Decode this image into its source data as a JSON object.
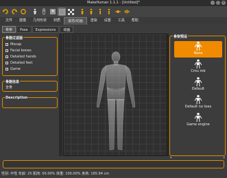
{
  "window": {
    "title": "MakeHuman 1.1.1 - [Untitled]*"
  },
  "toolbar": {
    "icons": [
      "undo-icon",
      "redo-icon",
      "reset-icon",
      "smooth-icon",
      "wireframe-icon",
      "background-icon",
      "grid-icon",
      "front-view-icon",
      "back-view-icon",
      "left-view-icon",
      "right-view-icon",
      "top-view-icon",
      "bottom-view-icon"
    ]
  },
  "menu": {
    "items": [
      "文件",
      "建模",
      "几何形状",
      "材质",
      "姿态/动画",
      "渲染",
      "设置",
      "工具",
      "帮助"
    ],
    "active_index": 4
  },
  "subtabs": {
    "items": [
      "骨架",
      "Pose",
      "Expressions",
      "动画"
    ],
    "active_index": 0
  },
  "left_panel": {
    "filter": {
      "title": "骨骼过滤器",
      "options": [
        "Mocap",
        "Facial bones",
        "Detailed hands",
        "Detailed feet",
        "Game"
      ]
    },
    "info": {
      "title": "骨骼信息",
      "value": "全骨"
    },
    "description": {
      "title": "Description"
    }
  },
  "right_panel": {
    "title": "骨架预设",
    "presets": [
      "None",
      "Cmu mb",
      "Default",
      "Default no toes",
      "Game engine"
    ],
    "selected_index": 0
  },
  "status": {
    "text": "性别: 中性 年龄: 25 肌肉: 50.00% 体重: 100.00% 身高: 165.94 cm"
  },
  "colors": {
    "accent": "#e08a00",
    "background": "#3c3c3c",
    "viewport": "#2f2f2f"
  }
}
